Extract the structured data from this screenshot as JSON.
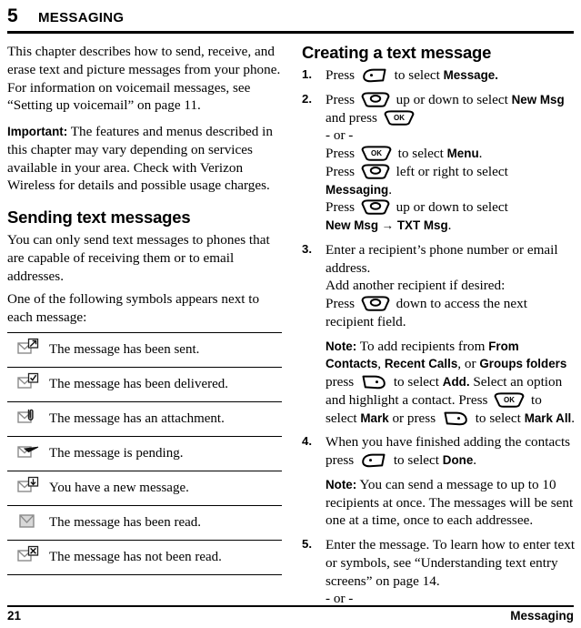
{
  "chapter": {
    "number": "5",
    "title": "MESSAGING"
  },
  "left_column": {
    "intro": "This chapter describes how to send, receive, and erase text and picture messages from your phone. For information on voicemail messages, see “Setting up voicemail” on page 11.",
    "important_label": "Important:",
    "important_text": "The features and menus described in this chapter may vary depending on services available in your area. Check with Verizon Wireless for details and possible usage charges.",
    "section_title": "Sending text messages",
    "section_p1": "You can only send text messages to phones that are capable of receiving them or to email addresses.",
    "section_p2": "One of the following symbols appears next to each message:",
    "symbol_rows": [
      {
        "icon": "envelope-sent-icon",
        "text": "The message has been sent."
      },
      {
        "icon": "envelope-delivered-icon",
        "text": "The message has been delivered."
      },
      {
        "icon": "envelope-attachment-icon",
        "text": "The message has an attachment."
      },
      {
        "icon": "envelope-pending-icon",
        "text": "The message is pending."
      },
      {
        "icon": "envelope-new-icon",
        "text": "You have a new message."
      },
      {
        "icon": "envelope-read-icon",
        "text": "The message has been read."
      },
      {
        "icon": "envelope-unread-icon",
        "text": "The message has not been read."
      }
    ]
  },
  "right_column": {
    "section_title": "Creating a text message",
    "steps": [
      {
        "num": "1.",
        "lines": [
          {
            "parts": [
              {
                "t": "text",
                "v": "Press "
              },
              {
                "t": "key",
                "v": "left-soft-key-icon"
              },
              {
                "t": "text",
                "v": " to select "
              },
              {
                "t": "bold",
                "v": "Message."
              }
            ]
          }
        ]
      },
      {
        "num": "2.",
        "lines": [
          {
            "parts": [
              {
                "t": "text",
                "v": "Press "
              },
              {
                "t": "key",
                "v": "navigation-key-icon"
              },
              {
                "t": "text",
                "v": " up or down to select "
              },
              {
                "t": "bold",
                "v": "New Msg"
              },
              {
                "t": "text",
                "v": " and press "
              },
              {
                "t": "key",
                "v": "ok-key-icon"
              }
            ]
          },
          {
            "parts": [
              {
                "t": "text",
                "v": "- or -"
              }
            ]
          },
          {
            "parts": [
              {
                "t": "text",
                "v": "Press "
              },
              {
                "t": "key",
                "v": "ok-key-icon"
              },
              {
                "t": "text",
                "v": " to select "
              },
              {
                "t": "bold",
                "v": "Menu"
              },
              {
                "t": "text",
                "v": "."
              }
            ]
          },
          {
            "parts": [
              {
                "t": "text",
                "v": "Press "
              },
              {
                "t": "key",
                "v": "navigation-key-icon"
              },
              {
                "t": "text",
                "v": " left or right to select "
              },
              {
                "t": "bold",
                "v": "Messaging"
              },
              {
                "t": "text",
                "v": "."
              }
            ]
          },
          {
            "parts": [
              {
                "t": "text",
                "v": "Press "
              },
              {
                "t": "key",
                "v": "navigation-key-icon"
              },
              {
                "t": "text",
                "v": " up or down to select"
              }
            ]
          },
          {
            "parts": [
              {
                "t": "bold",
                "v": "New Msg → TXT Msg"
              },
              {
                "t": "text",
                "v": "."
              }
            ]
          }
        ]
      },
      {
        "num": "3.",
        "lines": [
          {
            "parts": [
              {
                "t": "text",
                "v": "Enter a recipient’s phone number or email address."
              }
            ]
          },
          {
            "parts": [
              {
                "t": "text",
                "v": "Add another recipient if desired:"
              }
            ]
          },
          {
            "parts": [
              {
                "t": "text",
                "v": "Press "
              },
              {
                "t": "key",
                "v": "navigation-key-icon"
              },
              {
                "t": "text",
                "v": " down to access the next recipient field."
              }
            ]
          }
        ],
        "note": {
          "label": "Note:",
          "parts": [
            {
              "t": "text",
              "v": " To add recipients from "
            },
            {
              "t": "bold",
              "v": "From Contacts"
            },
            {
              "t": "text",
              "v": ", "
            },
            {
              "t": "bold",
              "v": "Recent Calls"
            },
            {
              "t": "text",
              "v": ", or "
            },
            {
              "t": "bold",
              "v": "Groups folders"
            },
            {
              "t": "text",
              "v": " press "
            },
            {
              "t": "key",
              "v": "right-soft-key-icon"
            },
            {
              "t": "text",
              "v": " to select "
            },
            {
              "t": "bold",
              "v": "Add."
            },
            {
              "t": "text",
              "v": " Select an option and highlight a contact. Press "
            },
            {
              "t": "key",
              "v": "ok-key-icon"
            },
            {
              "t": "text",
              "v": " to select "
            },
            {
              "t": "bold",
              "v": "Mark"
            },
            {
              "t": "text",
              "v": " or press "
            },
            {
              "t": "key",
              "v": "right-soft-key-icon"
            },
            {
              "t": "text",
              "v": " to select "
            },
            {
              "t": "bold",
              "v": "Mark All"
            },
            {
              "t": "text",
              "v": "."
            }
          ]
        }
      },
      {
        "num": "4.",
        "lines": [
          {
            "parts": [
              {
                "t": "text",
                "v": "When you have finished adding the contacts press "
              },
              {
                "t": "key",
                "v": "left-soft-key-icon"
              },
              {
                "t": "text",
                "v": " to select "
              },
              {
                "t": "bold",
                "v": "Done"
              },
              {
                "t": "text",
                "v": "."
              }
            ]
          }
        ],
        "note": {
          "label": "Note:",
          "parts": [
            {
              "t": "text",
              "v": " You can send a message to up to 10 recipients at once. The messages will be sent one at a time, once to each addressee."
            }
          ]
        }
      },
      {
        "num": "5.",
        "lines": [
          {
            "parts": [
              {
                "t": "text",
                "v": "Enter the message. To learn how to enter text or symbols, see “Understanding text entry screens” on page 14."
              }
            ]
          },
          {
            "parts": [
              {
                "t": "text",
                "v": "- or -"
              }
            ]
          }
        ]
      }
    ]
  },
  "footer": {
    "page_number": "21",
    "chapter_label": "Messaging"
  },
  "colors": {
    "text": "#000000",
    "rule": "#000000",
    "icon_gray": "#8a8a8a",
    "background": "#ffffff"
  }
}
